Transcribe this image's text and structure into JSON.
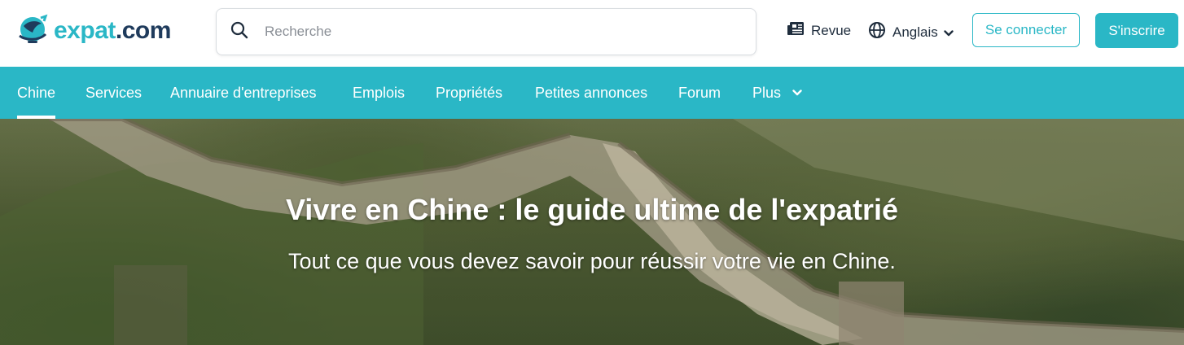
{
  "header": {
    "logo_text": "expat.com",
    "search_placeholder": "Recherche",
    "revue_label": "Revue",
    "language_label": "Anglais",
    "login_label": "Se connecter",
    "signup_label": "S'inscrire"
  },
  "nav": {
    "items": [
      {
        "label": "Chine",
        "active": true
      },
      {
        "label": "Services"
      },
      {
        "label": "Annuaire d'entreprises"
      },
      {
        "label": "Emplois"
      },
      {
        "label": "Propriétés"
      },
      {
        "label": "Petites annonces"
      },
      {
        "label": "Forum"
      },
      {
        "label": "Plus"
      }
    ]
  },
  "hero": {
    "title": "Vivre en Chine : le guide ultime de l'expatrié",
    "subtitle": "Tout ce que vous devez savoir pour réussir votre vie en Chine."
  },
  "colors": {
    "brand": "#2ab7c6",
    "brand_dark": "#1f3b5c",
    "text": "#1f2d3d"
  },
  "icons": [
    "search-icon",
    "newspaper-icon",
    "globe-icon",
    "chevron-down-icon",
    "logo-globe-icon"
  ]
}
